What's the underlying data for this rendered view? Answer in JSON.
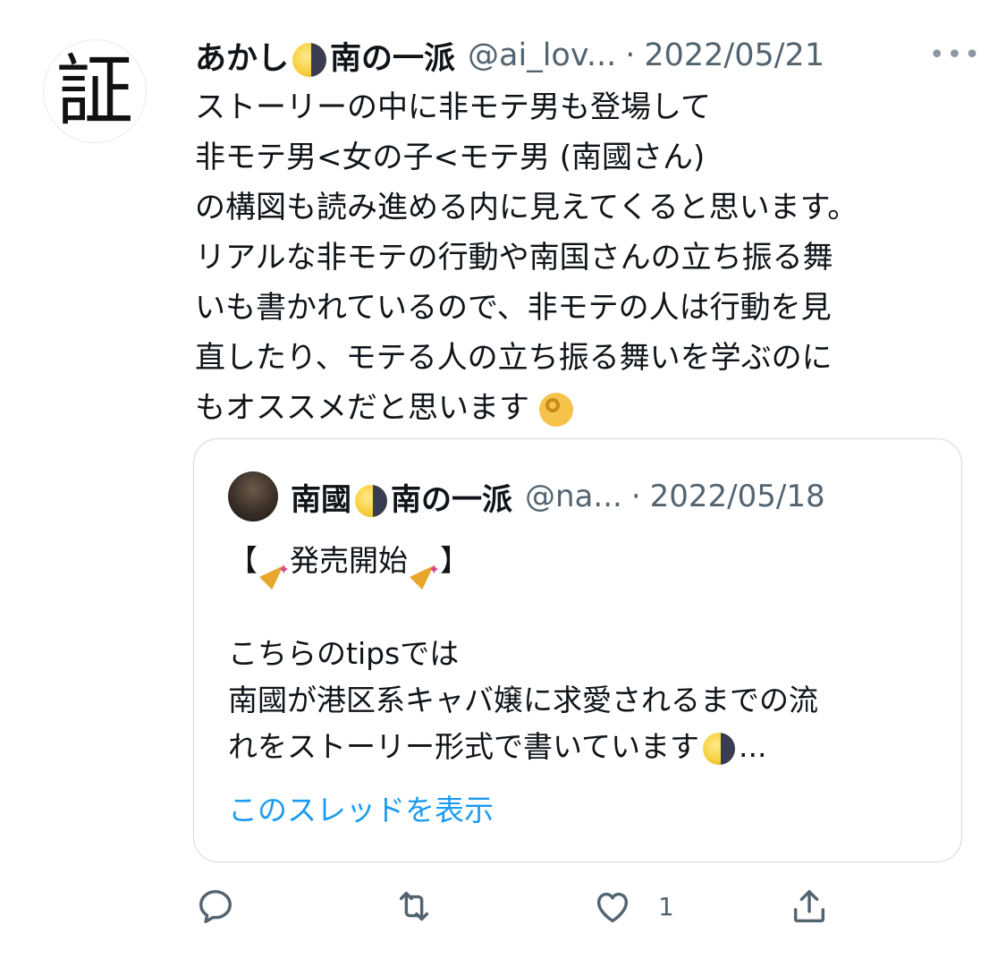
{
  "tweet": {
    "avatar_char": "証",
    "name_part1": "あかし",
    "name_part2": "南の一派",
    "handle": "@ai_lov...",
    "separator": "·",
    "date": "2022/05/21",
    "more": "•••",
    "lines": [
      "ストーリーの中に非モテ男も登場して",
      "非モテ男<女の子<モテ男 (南國さん)",
      "の構図も読み進める内に見えてくると思います。",
      "リアルな非モテの行動や南国さんの立ち振る舞",
      "いも書かれているので、非モテの人は行動を見",
      "直したり、モテる人の立ち振る舞いを学ぶのに",
      "もオススメだと思います"
    ]
  },
  "quote": {
    "name_part1": "南國",
    "name_part2": "南の一派",
    "handle": "@na...",
    "separator": "·",
    "date": "2022/05/18",
    "line1_open": "【",
    "line1_mid": "発売開始",
    "line1_close": "】",
    "line2": "こちらのtipsでは",
    "line3": "南國が港区系キャバ嬢に求愛されるまでの流",
    "line4": "れをストーリー形式で書いています",
    "line4_ellipsis": "...",
    "show_thread": "このスレッドを表示"
  },
  "actions": {
    "like_count": "1"
  },
  "colors": {
    "link": "#1d9bf0",
    "secondary": "#536471",
    "border": "#cfd9de"
  }
}
